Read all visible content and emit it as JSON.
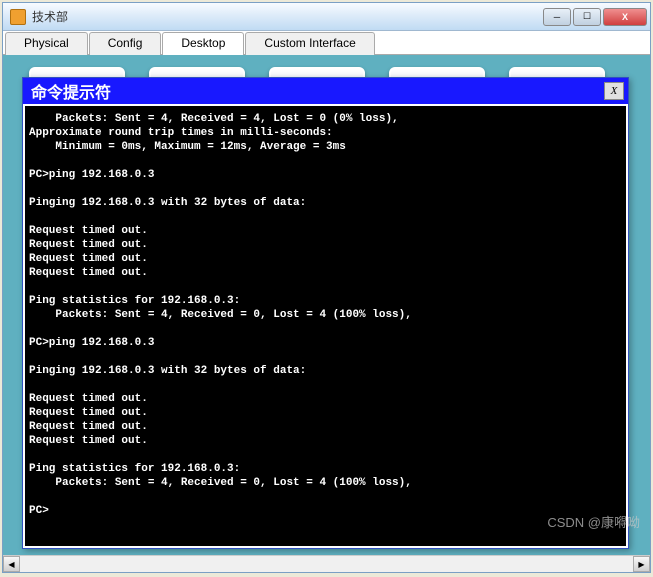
{
  "window": {
    "title": "技术部"
  },
  "tabs": [
    {
      "label": "Physical"
    },
    {
      "label": "Config"
    },
    {
      "label": "Desktop"
    },
    {
      "label": "Custom Interface"
    }
  ],
  "cmd": {
    "title": "命令提示符",
    "close_label": "X",
    "lines": [
      "    Packets: Sent = 4, Received = 4, Lost = 0 (0% loss),",
      "Approximate round trip times in milli-seconds:",
      "    Minimum = 0ms, Maximum = 12ms, Average = 3ms",
      "",
      "PC>ping 192.168.0.3",
      "",
      "Pinging 192.168.0.3 with 32 bytes of data:",
      "",
      "Request timed out.",
      "Request timed out.",
      "Request timed out.",
      "Request timed out.",
      "",
      "Ping statistics for 192.168.0.3:",
      "    Packets: Sent = 4, Received = 0, Lost = 4 (100% loss),",
      "",
      "PC>ping 192.168.0.3",
      "",
      "Pinging 192.168.0.3 with 32 bytes of data:",
      "",
      "Request timed out.",
      "Request timed out.",
      "Request timed out.",
      "Request timed out.",
      "",
      "Ping statistics for 192.168.0.3:",
      "    Packets: Sent = 4, Received = 0, Lost = 4 (100% loss),",
      "",
      "PC>"
    ]
  },
  "watermark": "CSDN @康嘚呦"
}
